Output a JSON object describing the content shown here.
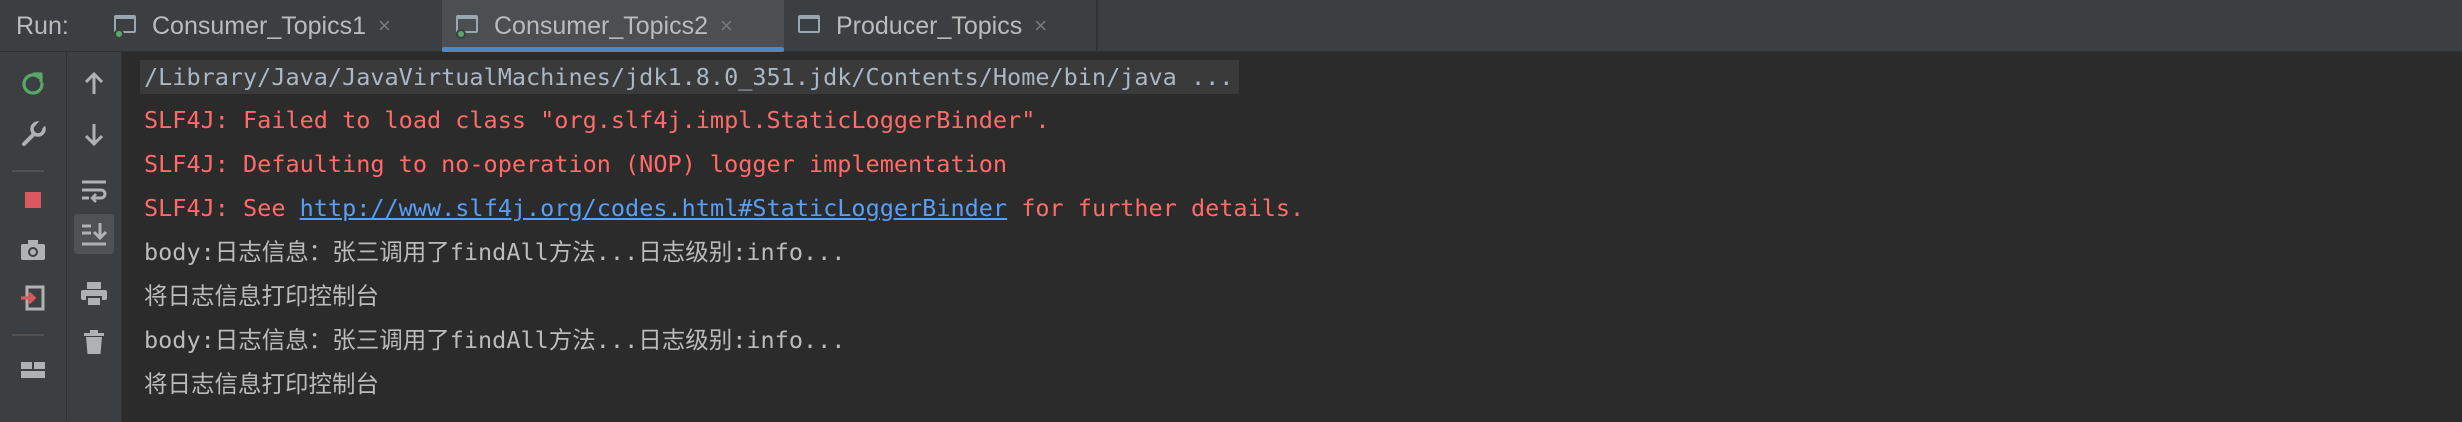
{
  "run_panel": {
    "label": "Run:",
    "tabs": [
      {
        "title": "Consumer_Topics1",
        "active": false
      },
      {
        "title": "Consumer_Topics2",
        "active": true
      },
      {
        "title": "Producer_Topics",
        "active": false
      }
    ],
    "close_glyph": "×"
  },
  "toolbar_left": [
    {
      "icon": "rerun-icon",
      "color": "#59a869"
    },
    {
      "icon": "wrench-icon",
      "color": "#afb1b3"
    },
    {
      "icon": "stop-icon",
      "color": "#db5860"
    },
    {
      "icon": "camera-icon",
      "color": "#afb1b3"
    },
    {
      "icon": "exit-icon",
      "color": "#db5860"
    },
    {
      "icon": "layout-icon",
      "color": "#afb1b3"
    }
  ],
  "toolbar_right": [
    {
      "icon": "arrow-up-icon"
    },
    {
      "icon": "arrow-down-icon"
    },
    {
      "icon": "soft-wrap-icon"
    },
    {
      "icon": "scroll-to-end-icon",
      "selected": true
    },
    {
      "icon": "print-icon"
    },
    {
      "icon": "trash-icon"
    }
  ],
  "console": {
    "command": "/Library/Java/JavaVirtualMachines/jdk1.8.0_351.jdk/Contents/Home/bin/java ...",
    "err1": "SLF4J: Failed to load class \"org.slf4j.impl.StaticLoggerBinder\".",
    "err2": "SLF4J: Defaulting to no-operation (NOP) logger implementation",
    "err3_prefix": "SLF4J: See ",
    "err3_link": "http://www.slf4j.org/codes.html#StaticLoggerBinder",
    "err3_suffix": " for further details.",
    "out1": "body:日志信息：张三调用了findAll方法...日志级别:info...",
    "out2": "将日志信息打印控制台",
    "out3": "body:日志信息：张三调用了findAll方法...日志级别:info...",
    "out4": "将日志信息打印控制台"
  },
  "colors": {
    "error": "#ff6b68",
    "link": "#589df6",
    "output": "#bbbbbb",
    "active_tab_underline": "#4a88c7"
  }
}
